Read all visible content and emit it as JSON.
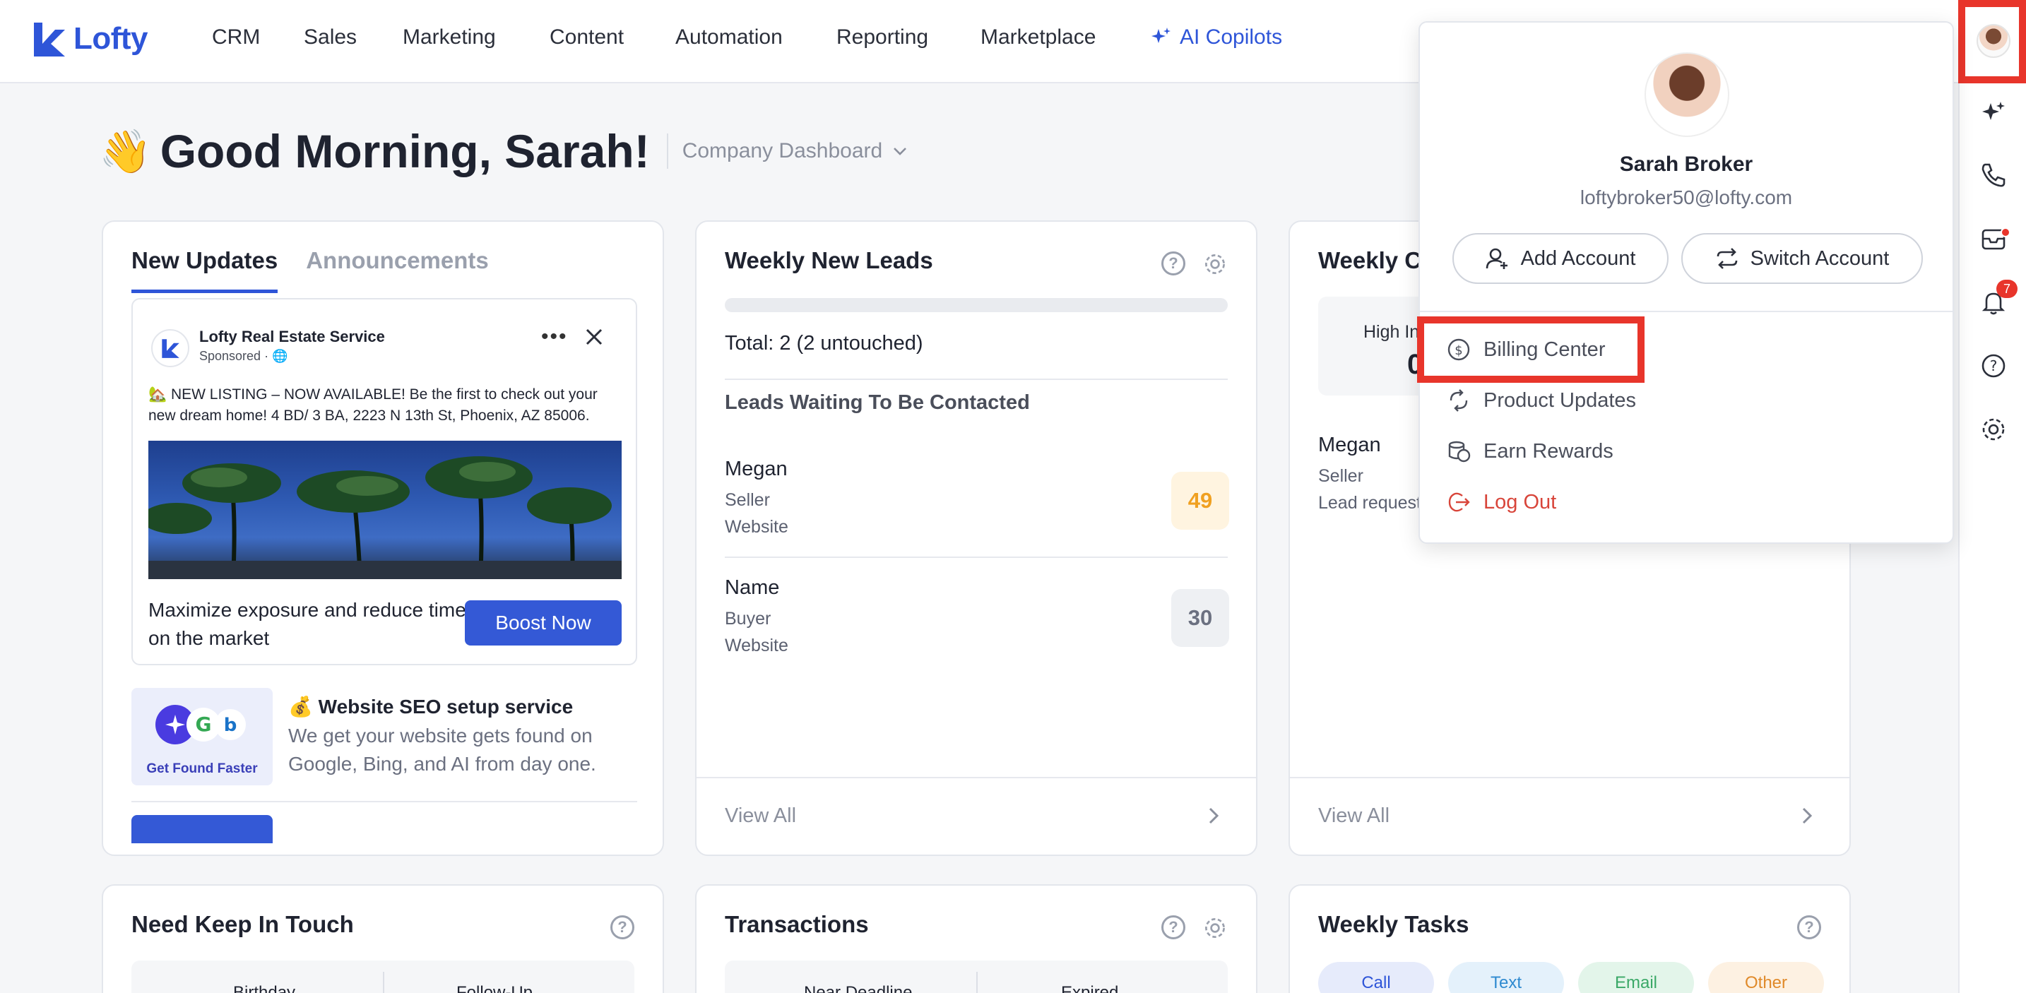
{
  "brand": {
    "name": "Lofty"
  },
  "nav": {
    "items": [
      "CRM",
      "Sales",
      "Marketing",
      "Content",
      "Automation",
      "Reporting",
      "Marketplace"
    ],
    "ai_label": "AI Copilots"
  },
  "rail": {
    "notification_count": "7"
  },
  "greeting": {
    "emoji": "👋",
    "text": "Good Morning, Sarah!",
    "dashboard_select": "Company Dashboard"
  },
  "updates": {
    "tabs": [
      "New Updates",
      "Announcements"
    ],
    "ad": {
      "page_name": "Lofty Real Estate Service",
      "sponsored": "Sponsored ·",
      "text": "🏡 NEW LISTING – NOW AVAILABLE! Be the first to check out your new dream home! 4 BD/ 3 BA, 2223 N 13th St, Phoenix, AZ 85006.",
      "footer_text": "Maximize exposure and reduce time on the market",
      "button": "Boost Now"
    },
    "seo": {
      "img_caption": "Get Found Faster",
      "title": "💰 Website SEO setup service",
      "desc": "We get your website gets found on Google, Bing, and AI from day one."
    }
  },
  "leads": {
    "title": "Weekly New Leads",
    "total": "Total: 2 (2 untouched)",
    "section": "Leads Waiting To Be Contacted",
    "items": [
      {
        "name": "Megan",
        "type": "Seller",
        "source": "Website",
        "score": "49"
      },
      {
        "name": "Name",
        "type": "Buyer",
        "source": "Website",
        "score": "30"
      }
    ],
    "view_all": "View All"
  },
  "weekly_c": {
    "title": "Weekly C",
    "box_label": "High In",
    "box_value": "0",
    "lead_name": "Megan",
    "lead_type": "Seller",
    "lead_note": "Lead request",
    "view_all": "View All"
  },
  "keep_in_touch": {
    "title": "Need Keep In Touch",
    "subtabs": [
      "Birthday",
      "Follow-Up"
    ]
  },
  "transactions": {
    "title": "Transactions",
    "subtabs": [
      "Near Deadline",
      "Expired"
    ]
  },
  "tasks": {
    "title": "Weekly Tasks",
    "pills": [
      "Call",
      "Text",
      "Email",
      "Other"
    ]
  },
  "account_menu": {
    "name": "Sarah Broker",
    "email": "loftybroker50@lofty.com",
    "add_account": "Add Account",
    "switch_account": "Switch Account",
    "items": [
      "Billing Center",
      "Product Updates",
      "Earn Rewards",
      "Log Out"
    ]
  },
  "colors": {
    "accent": "#2e55d8",
    "highlight": "#e8352b",
    "score_warm": "#f0a020"
  }
}
